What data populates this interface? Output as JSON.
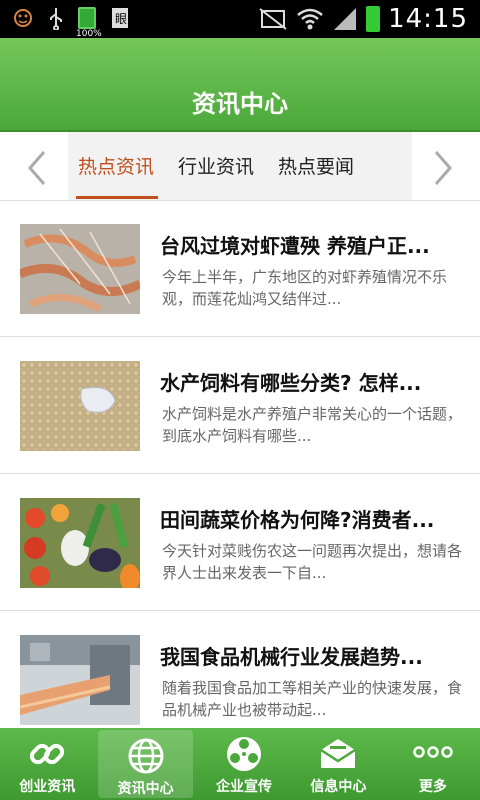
{
  "status_bar": {
    "battery_percent": "100%",
    "time": "14:15",
    "icons": [
      "face-icon",
      "usb-icon",
      "battery-icon",
      "doc-icon",
      "mute-icon",
      "wifi-icon",
      "signal-icon",
      "battery-icon"
    ]
  },
  "header": {
    "title": "资讯中心"
  },
  "tabs": [
    {
      "label": "热点资讯",
      "active": true
    },
    {
      "label": "行业资讯",
      "active": false
    },
    {
      "label": "热点要闻",
      "active": false
    }
  ],
  "articles": [
    {
      "title": "台风过境对虾遭殃 养殖户正...",
      "desc": "今年上半年，广东地区的对虾养殖情况不乐观，而莲花灿鸿又结伴过...",
      "thumb": "shrimp"
    },
    {
      "title": "水产饲料有哪些分类? 怎样...",
      "desc": " 水产饲料是水产养殖户非常关心的一个话题，到底水产饲料有哪些...",
      "thumb": "feed"
    },
    {
      "title": "田间蔬菜价格为何降?消费者...",
      "desc": "今天针对菜贱伤农这一问题再次提出，想请各界人士出来发表一下自...",
      "thumb": "vegetables"
    },
    {
      "title": "我国食品机械行业发展趋势...",
      "desc": "随着我国食品加工等相关产业的快速发展，食品机械产业也被带动起...",
      "thumb": "machinery"
    }
  ],
  "bottom_nav": [
    {
      "label": "创业资讯",
      "icon": "link-icon",
      "active": false
    },
    {
      "label": "资讯中心",
      "icon": "globe-icon",
      "active": true
    },
    {
      "label": "企业宣传",
      "icon": "film-reel-icon",
      "active": false
    },
    {
      "label": "信息中心",
      "icon": "envelope-icon",
      "active": false
    },
    {
      "label": "更多",
      "icon": "more-dots-icon",
      "active": false
    }
  ],
  "colors": {
    "header_green": "#4aa83a",
    "tab_active": "#c0501e"
  }
}
